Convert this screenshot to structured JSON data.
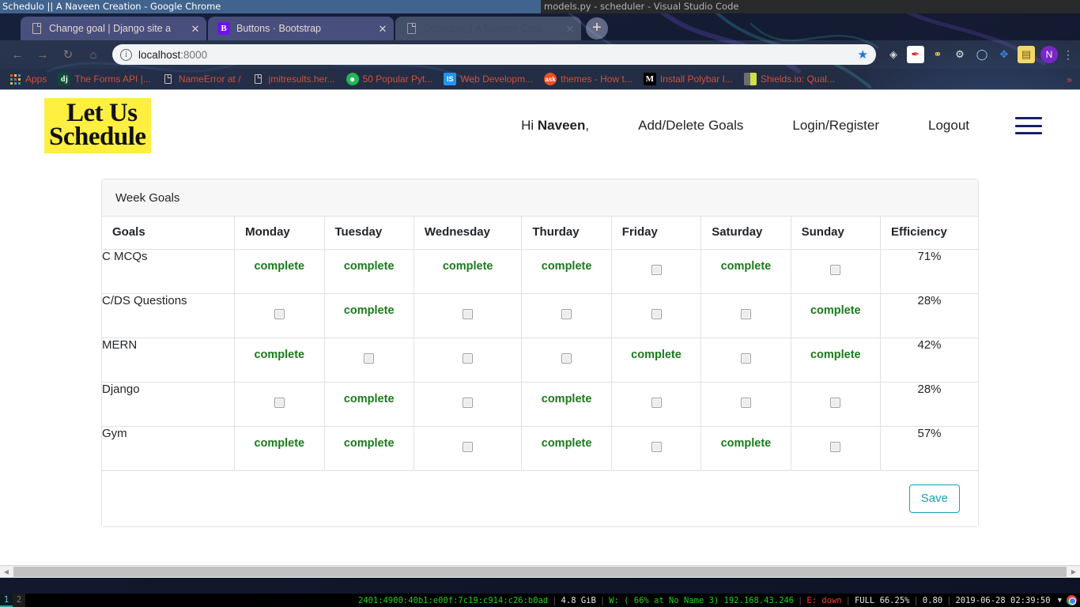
{
  "window_manager": {
    "active_title": "Schedulo || A Naveen Creation - Google Chrome",
    "inactive_title": "models.py - scheduler - Visual Studio Code"
  },
  "browser": {
    "tabs": [
      {
        "title": "Change goal | Django site a",
        "favicon": "page-icon",
        "active": false,
        "close_label": "✕"
      },
      {
        "title": "Buttons · Bootstrap",
        "favicon": "bootstrap-icon",
        "active": false,
        "close_label": "✕"
      },
      {
        "title": "Schedulo || A Naveen Crea",
        "favicon": "page-icon",
        "active": true,
        "close_label": "✕"
      }
    ],
    "new_tab_label": "+",
    "toolbar": {
      "back_label": "←",
      "forward_label": "→",
      "reload_label": "↻",
      "home_label": "⌂",
      "info_label": "i",
      "url_host": "localhost",
      "url_port": ":8000",
      "star_label": "★",
      "menu_label": "⋮",
      "profile_initial": "N",
      "extensions": [
        {
          "name": "globe-extension-icon",
          "glyph": "⊕",
          "color": "#d4d4d4",
          "bg": "transparent"
        },
        {
          "name": "red-note-extension-icon",
          "glyph": "✐",
          "color": "#d22",
          "bg": "#ffffff"
        },
        {
          "name": "python-extension-icon",
          "glyph": "🐍",
          "color": "#ffd43b",
          "bg": "transparent"
        },
        {
          "name": "gear-extension-icon",
          "glyph": "⚙",
          "color": "#dddddd",
          "bg": "transparent"
        },
        {
          "name": "ring-extension-icon",
          "glyph": "◯",
          "color": "#9fd8e8",
          "bg": "transparent"
        },
        {
          "name": "bluetooth-extension-icon",
          "glyph": "✥",
          "color": "#2f7fe0",
          "bg": "transparent"
        },
        {
          "name": "notes-extension-icon",
          "glyph": "▤",
          "color": "#e8b530",
          "bg": "#f5d97a"
        }
      ]
    },
    "bookmarks": [
      {
        "label": "Apps",
        "icon": "apps-grid-icon",
        "glyph": "∷"
      },
      {
        "label": "The Forms API |...",
        "icon": "django-icon",
        "glyph": "dj"
      },
      {
        "label": "NameError at /",
        "icon": "page-icon",
        "glyph": ""
      },
      {
        "label": "jmitresults.her...",
        "icon": "page-icon",
        "glyph": ""
      },
      {
        "label": "50 Popular Pyt...",
        "icon": "green-circle-icon",
        "glyph": "●"
      },
      {
        "label": "Web Developm...",
        "icon": "is-icon",
        "glyph": "IS"
      },
      {
        "label": "themes - How t...",
        "icon": "ask-icon",
        "glyph": "ask"
      },
      {
        "label": "Install Polybar I...",
        "icon": "medium-icon",
        "glyph": "M"
      },
      {
        "label": "Shields.io: Qual...",
        "icon": "battery-icon",
        "glyph": "▌"
      }
    ],
    "bookmarks_overflow_label": "»"
  },
  "site": {
    "brand": {
      "line1": "Let Us",
      "line2": "Schedule",
      "highlight_color": "#ffef40"
    },
    "nav_links": [
      {
        "name": "greeting",
        "prefix": "Hi ",
        "user": "Naveen",
        "suffix": ","
      },
      {
        "name": "add-delete-goals",
        "label": "Add/Delete Goals"
      },
      {
        "name": "login-register",
        "label": "Login/Register"
      },
      {
        "name": "logout",
        "label": "Logout"
      }
    ],
    "hamburger_label": "menu"
  },
  "card": {
    "header_title": "Week Goals",
    "save_label": "Save",
    "save_color": "#17a2b8",
    "complete_label": "complete",
    "complete_color": "#1a7a1a"
  },
  "chart_data": {
    "type": "table",
    "title": "Week Goals",
    "columns": [
      "Goals",
      "Monday",
      "Tuesday",
      "Wednesday",
      "Thurday",
      "Friday",
      "Saturday",
      "Sunday",
      "Efficiency"
    ],
    "rows": [
      {
        "goal": "C MCQs",
        "days": [
          "complete",
          "complete",
          "complete",
          "complete",
          "unchecked",
          "complete",
          "unchecked"
        ],
        "efficiency": "71%"
      },
      {
        "goal": "C/DS Questions",
        "days": [
          "unchecked",
          "complete",
          "unchecked",
          "unchecked",
          "unchecked",
          "unchecked",
          "complete"
        ],
        "efficiency": "28%"
      },
      {
        "goal": "MERN",
        "days": [
          "complete",
          "unchecked",
          "unchecked",
          "unchecked",
          "complete",
          "unchecked",
          "complete"
        ],
        "efficiency": "42%"
      },
      {
        "goal": "Django",
        "days": [
          "unchecked",
          "complete",
          "unchecked",
          "complete",
          "unchecked",
          "unchecked",
          "unchecked"
        ],
        "efficiency": "28%"
      },
      {
        "goal": "Gym",
        "days": [
          "complete",
          "complete",
          "unchecked",
          "complete",
          "unchecked",
          "complete",
          "unchecked"
        ],
        "efficiency": "57%"
      }
    ]
  },
  "status_bar": {
    "workspaces": [
      {
        "label": "1",
        "focused": true
      },
      {
        "label": "2",
        "focused": false
      }
    ],
    "segments": [
      {
        "name": "ip-address",
        "text": "2401:4900:40b1:e00f:7c19:c914:c26:b0ad",
        "color": "green"
      },
      {
        "name": "memory",
        "text": "4.8 GiB",
        "color": "white"
      },
      {
        "name": "wifi",
        "text": "W: ( 66% at No Name 3) 192.168.43.246",
        "color": "green"
      },
      {
        "name": "ethernet",
        "text": "E: down",
        "color": "red"
      },
      {
        "name": "battery",
        "text": "FULL 66.25%",
        "color": "white"
      },
      {
        "name": "load",
        "text": "0.80",
        "color": "white"
      },
      {
        "name": "datetime",
        "text": "2019-06-28 02:39:50",
        "color": "white"
      }
    ],
    "separator": "|",
    "tray_arrow": "▼"
  }
}
